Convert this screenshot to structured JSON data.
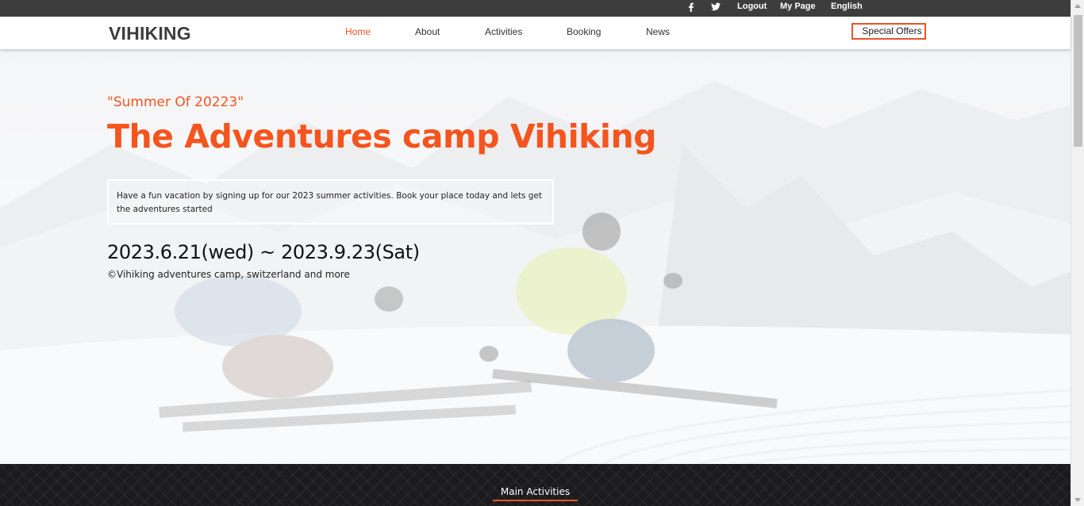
{
  "topbar": {
    "facebook_icon": "facebook-icon",
    "twitter_icon": "twitter-icon",
    "logout": "Logout",
    "mypage": "My Page",
    "language": "English"
  },
  "nav": {
    "logo": "VIHIKING",
    "items": [
      "Home",
      "About",
      "Activities",
      "Booking",
      "News"
    ],
    "active": "Home",
    "special_offers": "Special Offers"
  },
  "hero": {
    "subtitle": "\"Summer Of 20223\"",
    "title": "The Adventures camp Vihiking",
    "description": "Have a fun vacation by signing up for our 2023 summer activities. Book your place today and lets get the adventures started",
    "dates": "2023.6.21(wed) ~ 2023.9.23(Sat)",
    "copyright": "©Vihiking adventures camp, switzerland and more"
  },
  "activities": {
    "title": "Main Activities"
  },
  "colors": {
    "accent": "#f5541e",
    "topbar": "#3d3d3d",
    "footer": "#1b1b1d"
  }
}
